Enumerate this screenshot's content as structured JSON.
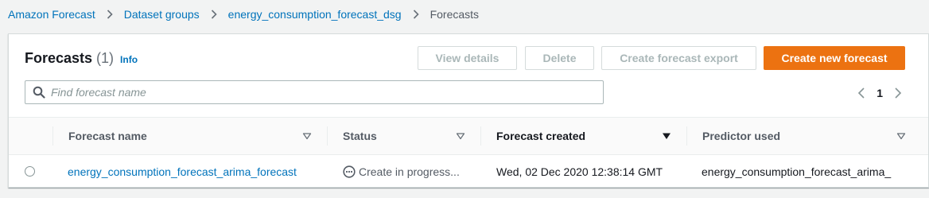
{
  "breadcrumb": [
    {
      "label": "Amazon Forecast"
    },
    {
      "label": "Dataset groups"
    },
    {
      "label": "energy_consumption_forecast_dsg"
    },
    {
      "label": "Forecasts"
    }
  ],
  "panel": {
    "title": "Forecasts",
    "count": "(1)",
    "info": "Info"
  },
  "actions": {
    "view_details": "View details",
    "delete": "Delete",
    "create_export": "Create forecast export",
    "create_new": "Create new forecast"
  },
  "search": {
    "placeholder": "Find forecast name",
    "value": ""
  },
  "pagination": {
    "current_page": "1"
  },
  "table": {
    "columns": [
      {
        "label": "Forecast name"
      },
      {
        "label": "Status"
      },
      {
        "label": "Forecast created"
      },
      {
        "label": "Predictor used"
      }
    ],
    "rows": [
      {
        "forecast_name": "energy_consumption_forecast_arima_forecast",
        "status": "Create in progress...",
        "created": "Wed, 02 Dec 2020 12:38:14 GMT",
        "predictor": "energy_consumption_forecast_arima_"
      }
    ]
  },
  "colors": {
    "link": "#0073bb",
    "primary": "#ec7211",
    "disabled_text": "#aab7b8"
  }
}
